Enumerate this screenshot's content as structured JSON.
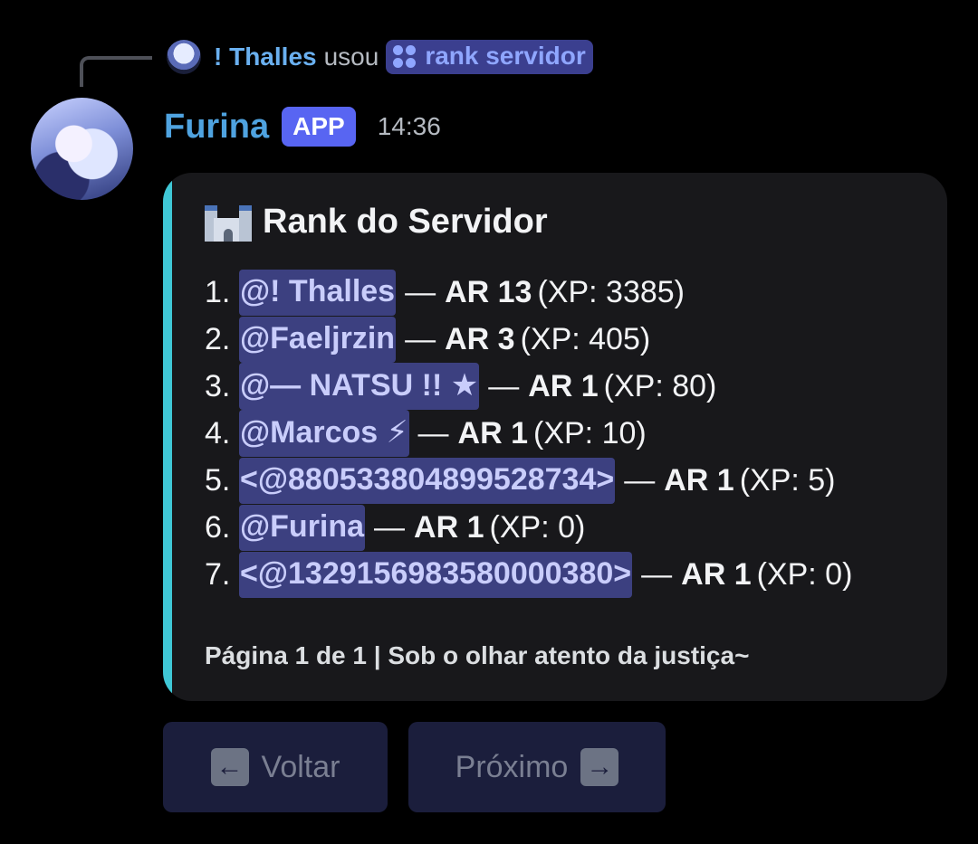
{
  "reply": {
    "username": "! Thalles",
    "verb": "usou",
    "command": "rank servidor",
    "command_icon": "slash-command-icon"
  },
  "message": {
    "author": "Furina",
    "badge": "APP",
    "timestamp": "14:36"
  },
  "embed": {
    "accent_color": "#3fc7d6",
    "title_icon": "castle-icon",
    "title": "Rank do Servidor",
    "entries": [
      {
        "num": "1.",
        "mention": "@! Thalles",
        "level": "AR 13",
        "xp": "(XP: 3385)"
      },
      {
        "num": "2.",
        "mention": "@Faeljrzin",
        "level": "AR 3",
        "xp": "(XP: 405)"
      },
      {
        "num": "3.",
        "mention": "@— NATSU !! ★",
        "level": "AR 1",
        "xp": "(XP: 80)"
      },
      {
        "num": "4.",
        "mention": "@Marcos ⚡",
        "level": "AR 1",
        "xp": "(XP: 10)"
      },
      {
        "num": "5.",
        "mention": "<@880533804899528734>",
        "level": "AR 1",
        "xp": "(XP: 5)"
      },
      {
        "num": "6.",
        "mention": "@Furina",
        "level": "AR 1",
        "xp": "(XP: 0)"
      },
      {
        "num": "7.",
        "mention": "<@1329156983580000380>",
        "level": "AR 1",
        "xp": "(XP: 0)"
      }
    ],
    "separator": "—",
    "footer": "Página 1 de 1 | Sob o olhar atento da justiça~"
  },
  "buttons": {
    "back_label": "Voltar",
    "back_icon": "left-arrow-icon",
    "next_label": "Próximo",
    "next_icon": "right-arrow-icon"
  },
  "colors": {
    "mention_bg": "#3c4080",
    "app_badge": "#5865f2",
    "username": "#4fa3e0",
    "button_bg": "#1b1e3c"
  }
}
